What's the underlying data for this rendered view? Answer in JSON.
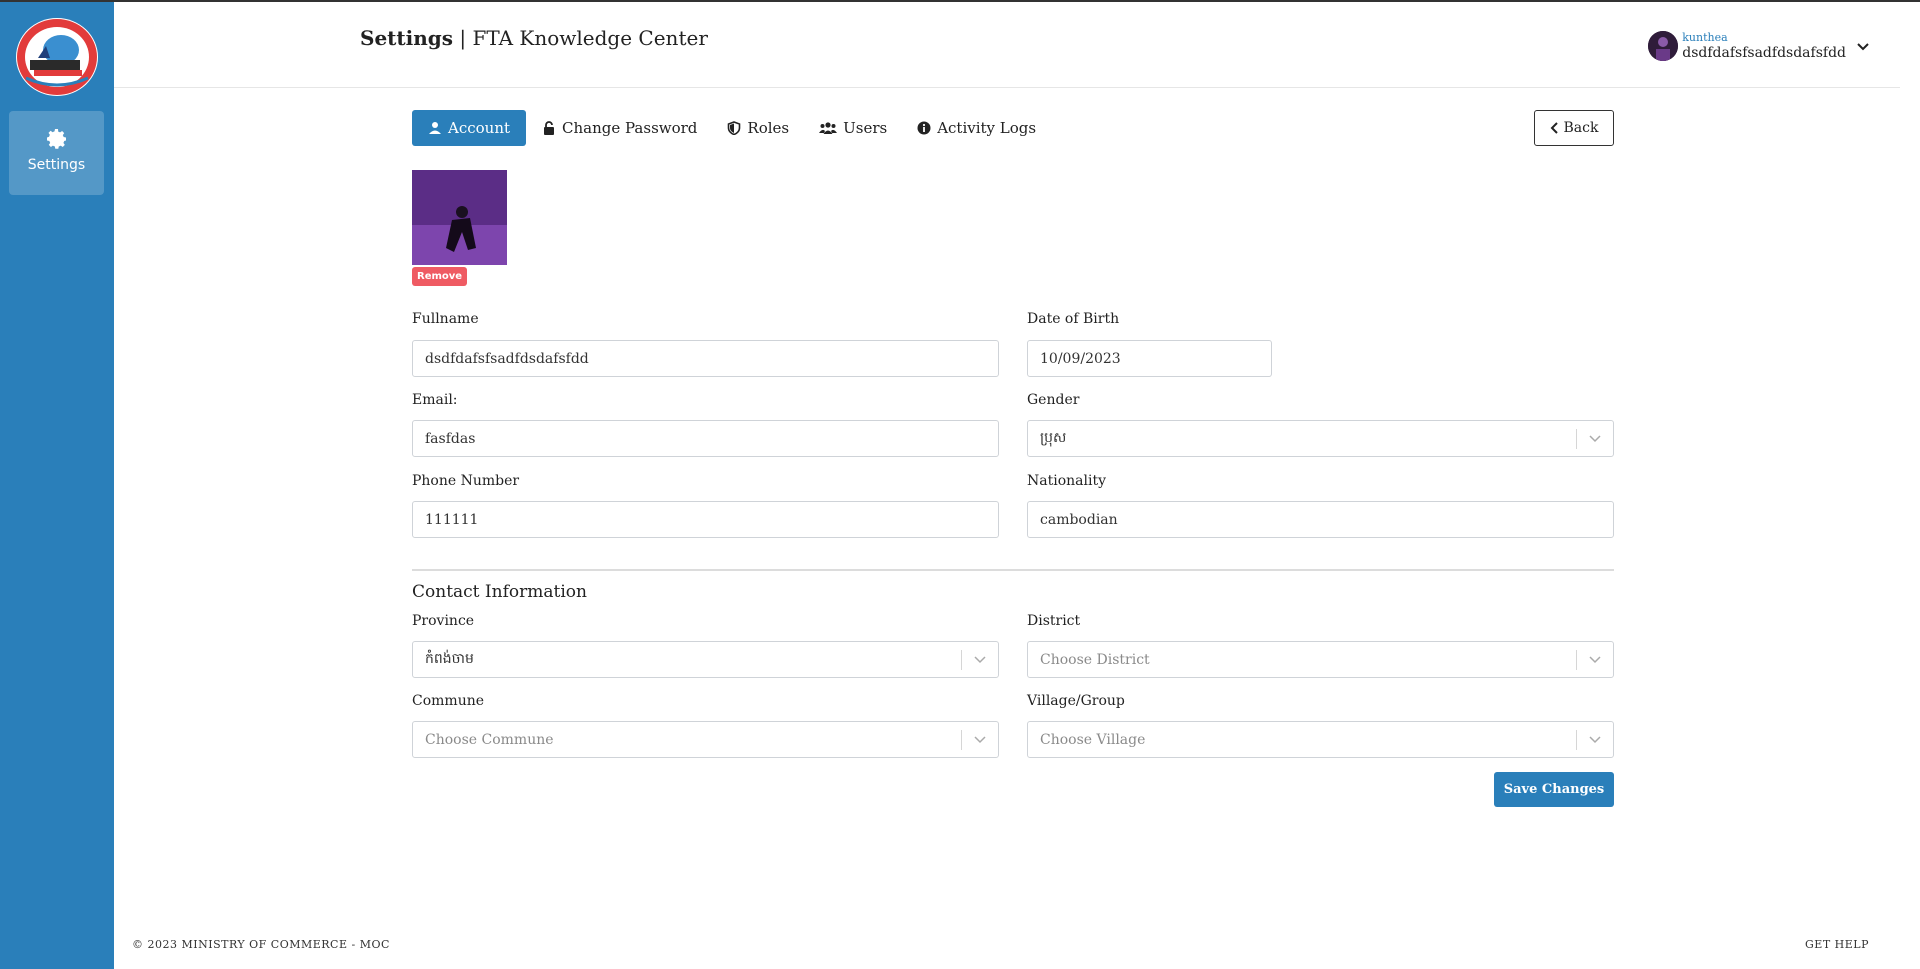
{
  "app": {
    "title_bold": "Settings",
    "title_sep": " | ",
    "title_rest": "FTA Knowledge Center"
  },
  "sidebar": {
    "logo_icon": "ministry-logo",
    "items": [
      {
        "label": "Settings",
        "icon": "gear-icon"
      }
    ]
  },
  "user": {
    "role": "kunthea",
    "name": "dsdfdafsfsadfdsdafsfdd",
    "menu_icon": "chevron-down-icon"
  },
  "tabs": [
    {
      "label": "Account",
      "icon": "user-icon",
      "active": true
    },
    {
      "label": "Change Password",
      "icon": "lock-icon",
      "active": false
    },
    {
      "label": "Roles",
      "icon": "shield-icon",
      "active": false
    },
    {
      "label": "Users",
      "icon": "users-icon",
      "active": false
    },
    {
      "label": "Activity Logs",
      "icon": "info-icon",
      "active": false
    }
  ],
  "back_button": {
    "label": "Back",
    "icon": "chevron-left-icon"
  },
  "profile": {
    "remove_label": "Remove"
  },
  "form": {
    "fullname": {
      "label": "Fullname",
      "value": "dsdfdafsfsadfdsdafsfdd"
    },
    "dob": {
      "label": "Date of Birth",
      "value": "10/09/2023"
    },
    "email": {
      "label": "Email:",
      "value": "fasfdas"
    },
    "gender": {
      "label": "Gender",
      "value": "ប្រុស"
    },
    "phone": {
      "label": "Phone Number",
      "value": "111111"
    },
    "nationality": {
      "label": "Nationality",
      "value": "cambodian"
    }
  },
  "contact": {
    "title": "Contact Information",
    "province": {
      "label": "Province",
      "value": "កំពង់ចាម"
    },
    "district": {
      "label": "District",
      "placeholder": "Choose District"
    },
    "commune": {
      "label": "Commune",
      "placeholder": "Choose Commune"
    },
    "village": {
      "label": "Village/Group",
      "placeholder": "Choose Village"
    }
  },
  "save_label": "Save Changes",
  "footer": {
    "copyright": "© 2023 MINISTRY OF COMMERCE - MOC",
    "help": "GET HELP"
  },
  "colors": {
    "primary": "#2a7fba",
    "danger": "#ef5b63"
  }
}
